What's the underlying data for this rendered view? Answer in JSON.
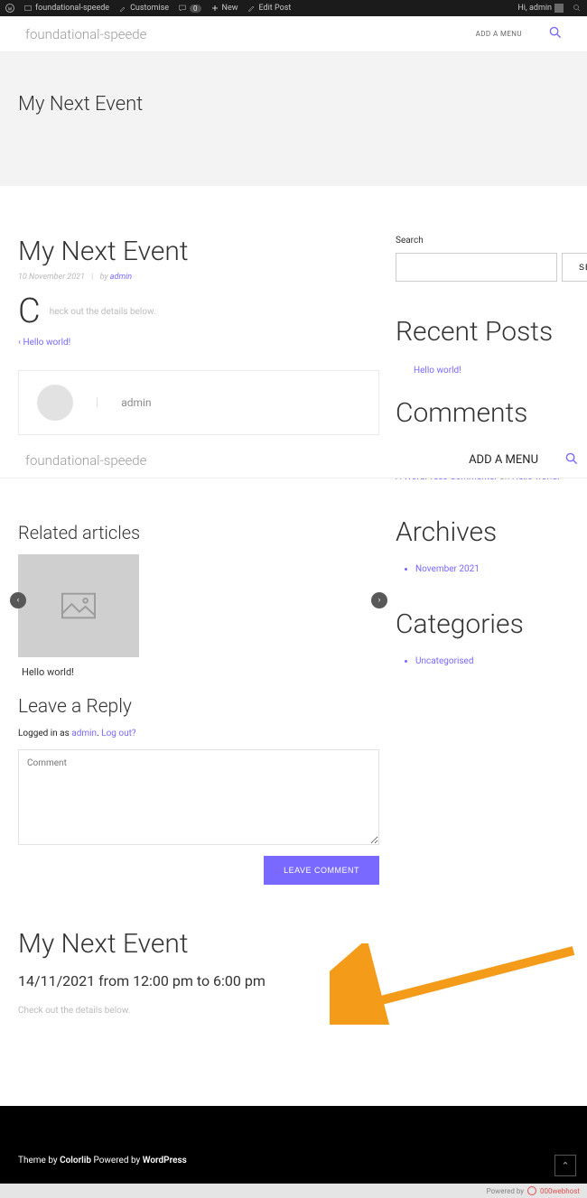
{
  "adminbar": {
    "site_name": "foundational-speede",
    "customise": "Customise",
    "comments_count": "0",
    "new": "New",
    "edit": "Edit Post",
    "greeting": "Hi, admin"
  },
  "nav": {
    "site_title": "foundational-speede",
    "add_menu": "ADD A MENU"
  },
  "hero": {
    "title": "My Next Event"
  },
  "post": {
    "title": "My Next Event",
    "date": "10 November 2021",
    "by": "by ",
    "author": "admin",
    "dropcap": "C",
    "excerpt": "heck out the details below.",
    "prev_link": "Hello world!"
  },
  "authorbox": {
    "name": "admin"
  },
  "sticky": {
    "site_title": "foundational-speede",
    "add_menu": "ADD A MENU"
  },
  "related": {
    "heading": "Related articles",
    "item_title": "Hello world!"
  },
  "reply": {
    "heading": "Leave a Reply",
    "logged_pre": "Logged in as ",
    "logged_user": "admin",
    "logged_sep": ". ",
    "logout": "Log out?",
    "placeholder": "Comment",
    "submit": "LEAVE COMMENT"
  },
  "event": {
    "title": "My Next Event",
    "time": "14/11/2021 from 12:00 pm to 6:00 pm",
    "desc": "Check out the details below."
  },
  "sidebar": {
    "search_label": "Search",
    "search_btn": "SEARCH",
    "recentposts_h": "Recent Posts",
    "recentpost_link": "Hello world!",
    "comments_h": "Comments",
    "comment_author": "A WordPress Commenter",
    "comment_on": " on ",
    "comment_post": "Hello world!",
    "archives_h": "Archives",
    "archive_item": "November 2021",
    "categories_h": "Categories",
    "category_item": "Uncategorised"
  },
  "footer": {
    "theme_by": "Theme by ",
    "colorlib": "Colorlib",
    "powered_by": " Powered by ",
    "wordpress": "WordPress",
    "backtop": "⌃"
  },
  "hostbadge": {
    "powered": "Powered by",
    "host": "000webhost"
  }
}
